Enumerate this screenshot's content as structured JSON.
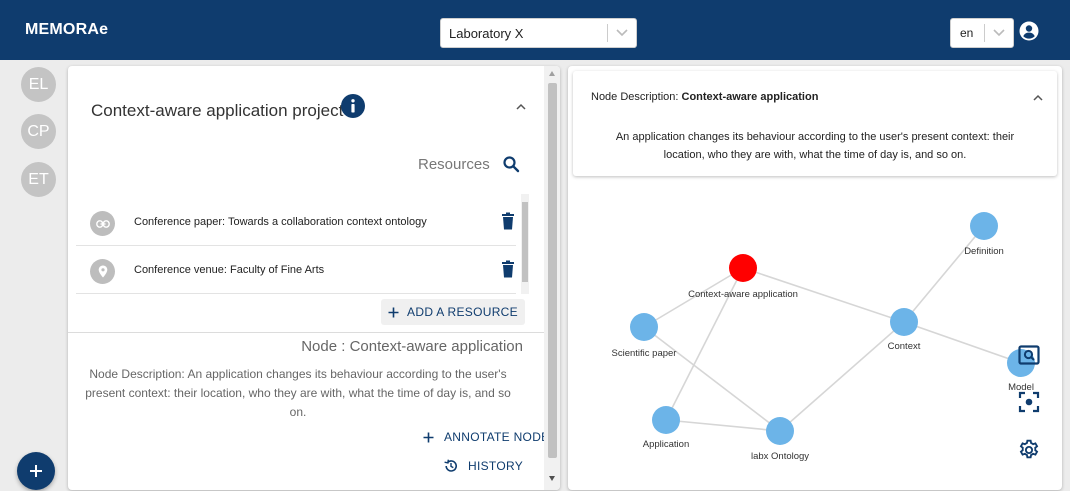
{
  "app": {
    "title": "MEMORAe"
  },
  "header": {
    "lab_select": {
      "value": "Laboratory X"
    },
    "lang_select": {
      "value": "en"
    }
  },
  "rail": {
    "items": [
      {
        "label": "EL"
      },
      {
        "label": "CP"
      },
      {
        "label": "ET"
      }
    ],
    "add_label": "+"
  },
  "project": {
    "title": "Context-aware application project",
    "resources_label": "Resources",
    "resources": [
      {
        "label": "Conference paper: Towards a collaboration context ontology",
        "icon": "link-icon"
      },
      {
        "label": "Conference venue: Faculty of Fine Arts",
        "icon": "location-pin-icon"
      }
    ],
    "add_resource_label": "ADD A RESOURCE"
  },
  "node": {
    "heading": "Node : Context-aware application",
    "description": "Node Description: An application changes its behaviour according to the user's present context: their location, who they are with, what the time of day is, and so on.",
    "annotate_label": "ANNOTATE NODE",
    "history_label": "HISTORY"
  },
  "description_card": {
    "label": "Node Description:",
    "node_name": "Context-aware application",
    "body": "An application changes its behaviour according to the user's present context: their location, who they are with, what the time of day is, and so on."
  },
  "graph": {
    "nodes": [
      {
        "id": "ctxapp",
        "label": "Context-aware application",
        "color": "#ff0000",
        "selected": true
      },
      {
        "id": "definition",
        "label": "Definition",
        "color": "#6cb4e8"
      },
      {
        "id": "context",
        "label": "Context",
        "color": "#6cb4e8"
      },
      {
        "id": "scipaper",
        "label": "Scientific paper",
        "color": "#6cb4e8"
      },
      {
        "id": "model",
        "label": "Model",
        "color": "#6cb4e8"
      },
      {
        "id": "application",
        "label": "Application",
        "color": "#6cb4e8"
      },
      {
        "id": "labx",
        "label": "labx Ontology",
        "color": "#6cb4e8"
      }
    ],
    "edges": [
      [
        "ctxapp",
        "context"
      ],
      [
        "ctxapp",
        "scipaper"
      ],
      [
        "ctxapp",
        "application"
      ],
      [
        "definition",
        "context"
      ],
      [
        "context",
        "model"
      ],
      [
        "context",
        "labx"
      ],
      [
        "scipaper",
        "labx"
      ],
      [
        "application",
        "labx"
      ]
    ]
  },
  "colors": {
    "primary": "#0f3c6e",
    "selected_node": "#ff0000",
    "node": "#6cb4e8"
  }
}
